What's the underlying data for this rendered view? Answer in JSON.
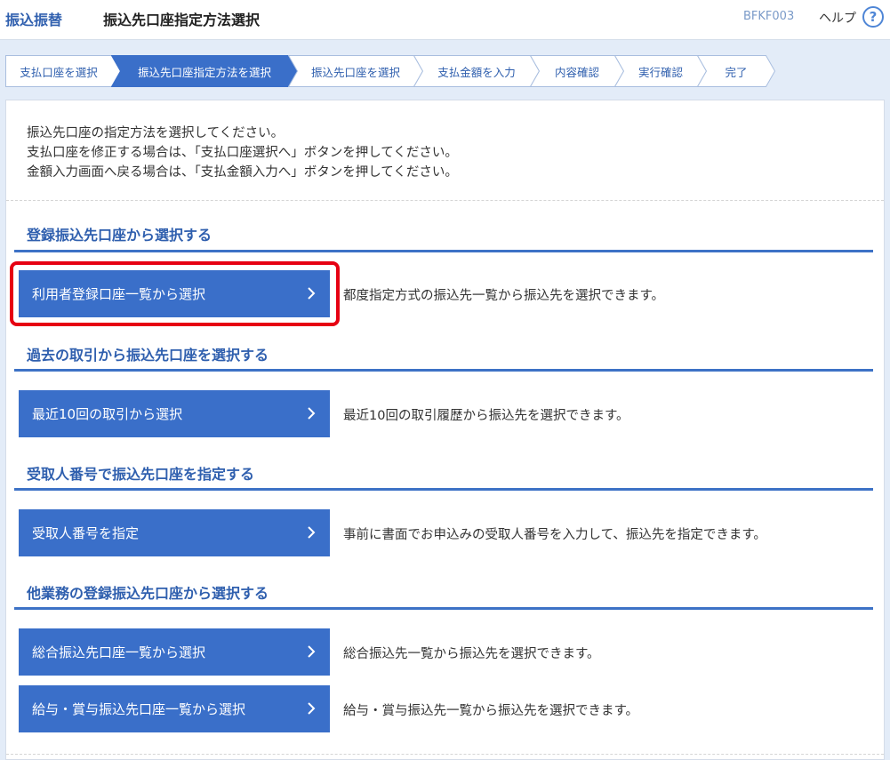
{
  "header": {
    "section": "振込振替",
    "title": "振込先口座指定方法選択",
    "screen_code": "BFKF003",
    "help_label": "ヘルプ",
    "help_icon": "?"
  },
  "steps": [
    {
      "label": "支払口座を選択",
      "active": false
    },
    {
      "label": "振込先口座指定方法を選択",
      "active": true
    },
    {
      "label": "振込先口座を選択",
      "active": false
    },
    {
      "label": "支払金額を入力",
      "active": false
    },
    {
      "label": "内容確認",
      "active": false
    },
    {
      "label": "実行確認",
      "active": false
    },
    {
      "label": "完了",
      "active": false
    }
  ],
  "intro": {
    "line1": "振込先口座の指定方法を選択してください。",
    "line2": "支払口座を修正する場合は、「支払口座選択へ」ボタンを押してください。",
    "line3": "金額入力画面へ戻る場合は、「支払金額入力へ」ボタンを押してください。"
  },
  "sections": {
    "registered": {
      "title": "登録振込先口座から選択する",
      "button": "利用者登録口座一覧から選択",
      "desc": "都度指定方式の振込先一覧から振込先を選択できます。"
    },
    "history": {
      "title": "過去の取引から振込先口座を選択する",
      "button": "最近10回の取引から選択",
      "desc": "最近10回の取引履歴から振込先を選択できます。"
    },
    "recipient_no": {
      "title": "受取人番号で振込先口座を指定する",
      "button": "受取人番号を指定",
      "desc": "事前に書面でお申込みの受取人番号を入力して、振込先を指定できます。"
    },
    "other": {
      "title": "他業務の登録振込先口座から選択する",
      "button1": "総合振込先口座一覧から選択",
      "desc1": "総合振込先一覧から振込先を選択できます。",
      "button2": "給与・賞与振込先口座一覧から選択",
      "desc2": "給与・賞与振込先一覧から振込先を選択できます。"
    }
  },
  "colors": {
    "accent": "#3a6fc9",
    "highlight": "#e60012",
    "step_active": "#3a6fc9"
  },
  "icons": {
    "chevron": "chevron-right-icon",
    "help": "help-circle-icon"
  }
}
